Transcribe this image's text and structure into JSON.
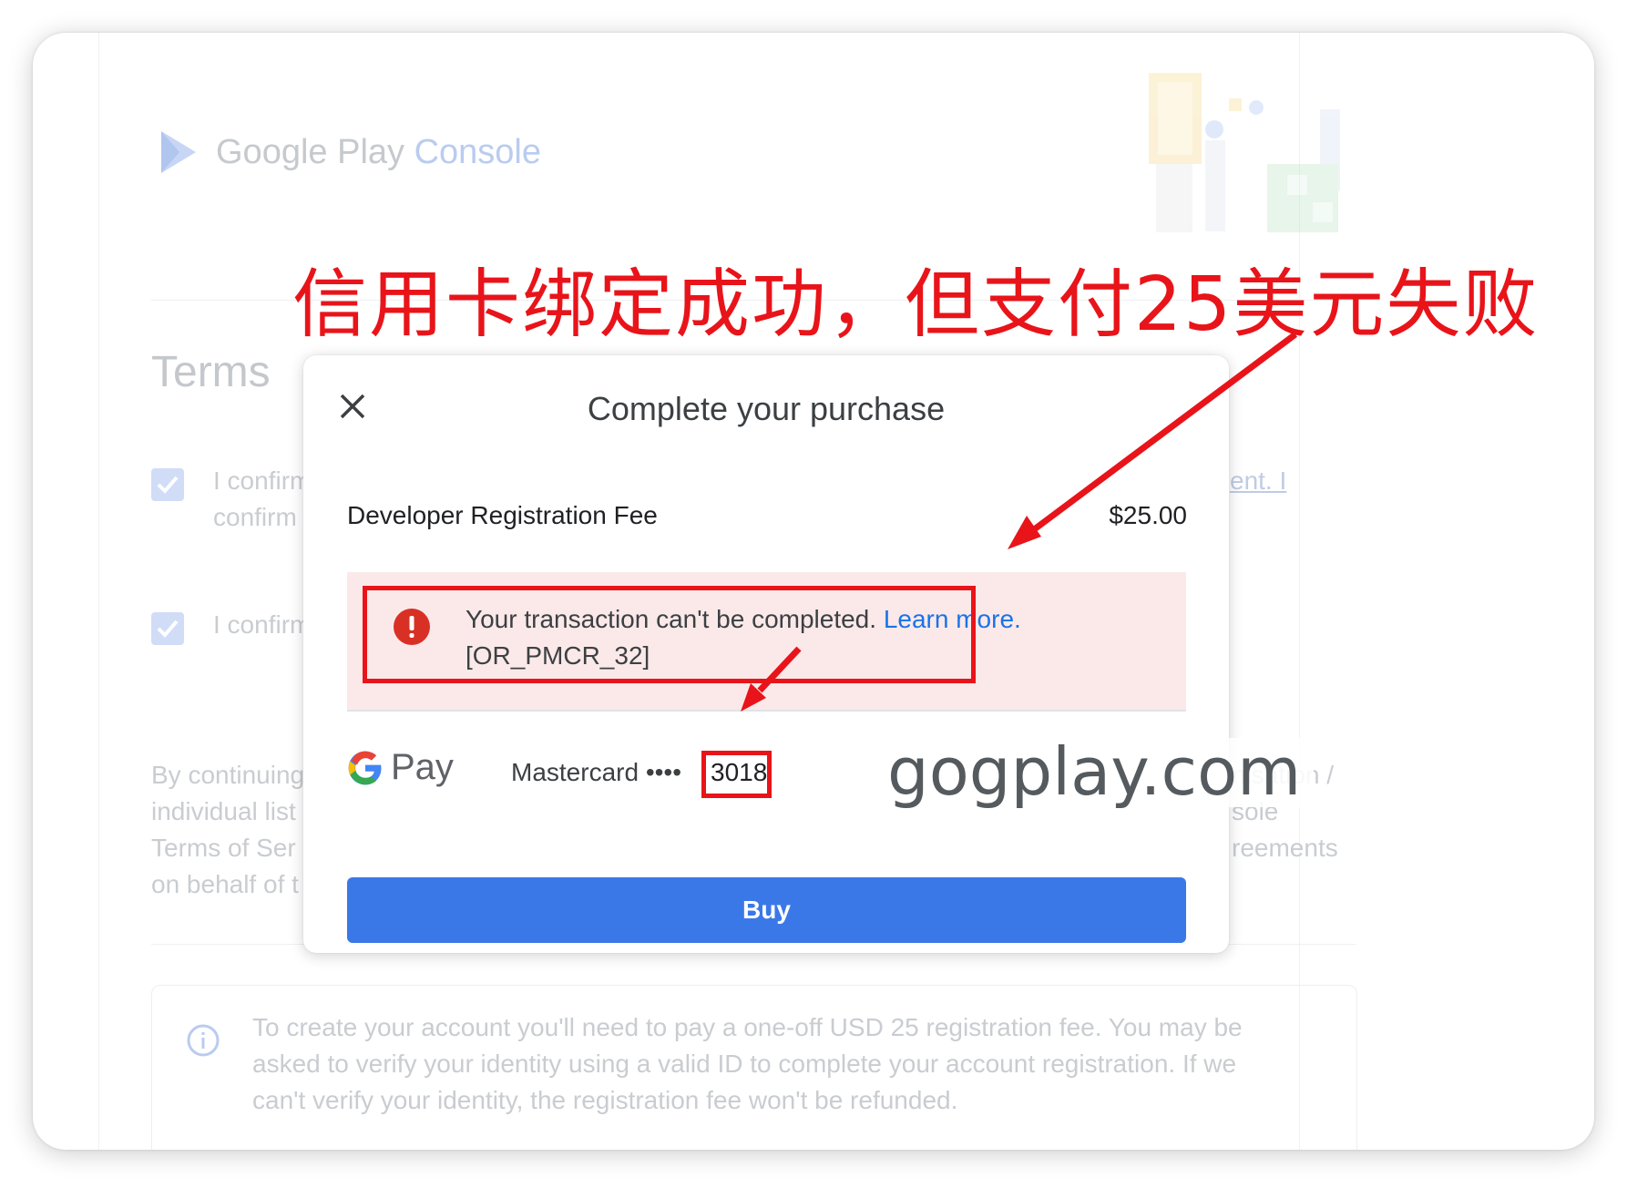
{
  "background": {
    "logo": {
      "text_part1": "Google Play",
      "text_part2": "Console"
    },
    "title": "Terms",
    "checkbox1_line1": "I confirm",
    "checkbox1_line1_right": "ent. I",
    "checkbox1_line2": "confirm",
    "checkbox2_line1": "I confirm",
    "para_left": [
      "By continuing",
      "individual list",
      "Terms of Ser",
      "on behalf of t"
    ],
    "para_right": [
      "nisation /",
      "sole",
      "reements"
    ],
    "info_text": "To create your account you'll need to pay a one-off USD 25 registration fee. You may be asked to verify your identity using a valid ID to complete your account registration. If we can't verify your identity, the registration fee won't be refunded."
  },
  "dialog": {
    "title": "Complete your purchase",
    "item_label": "Developer Registration Fee",
    "item_price": "$25.00",
    "error_text": "Your transaction can't be completed.",
    "error_link": "Learn more.",
    "error_code": "[OR_PMCR_32]",
    "pay_word": "Pay",
    "card_label": "Mastercard ••••",
    "card_digits": "3018",
    "buy_label": "Buy"
  },
  "annotation": {
    "headline": "信用卡绑定成功，但支付25美元失败",
    "watermark": "gogplay.com",
    "accent_color": "#e8141a"
  },
  "colors": {
    "buy_button": "#3b78e7",
    "link": "#1a73e8",
    "error_band": "#fbe9e9"
  }
}
